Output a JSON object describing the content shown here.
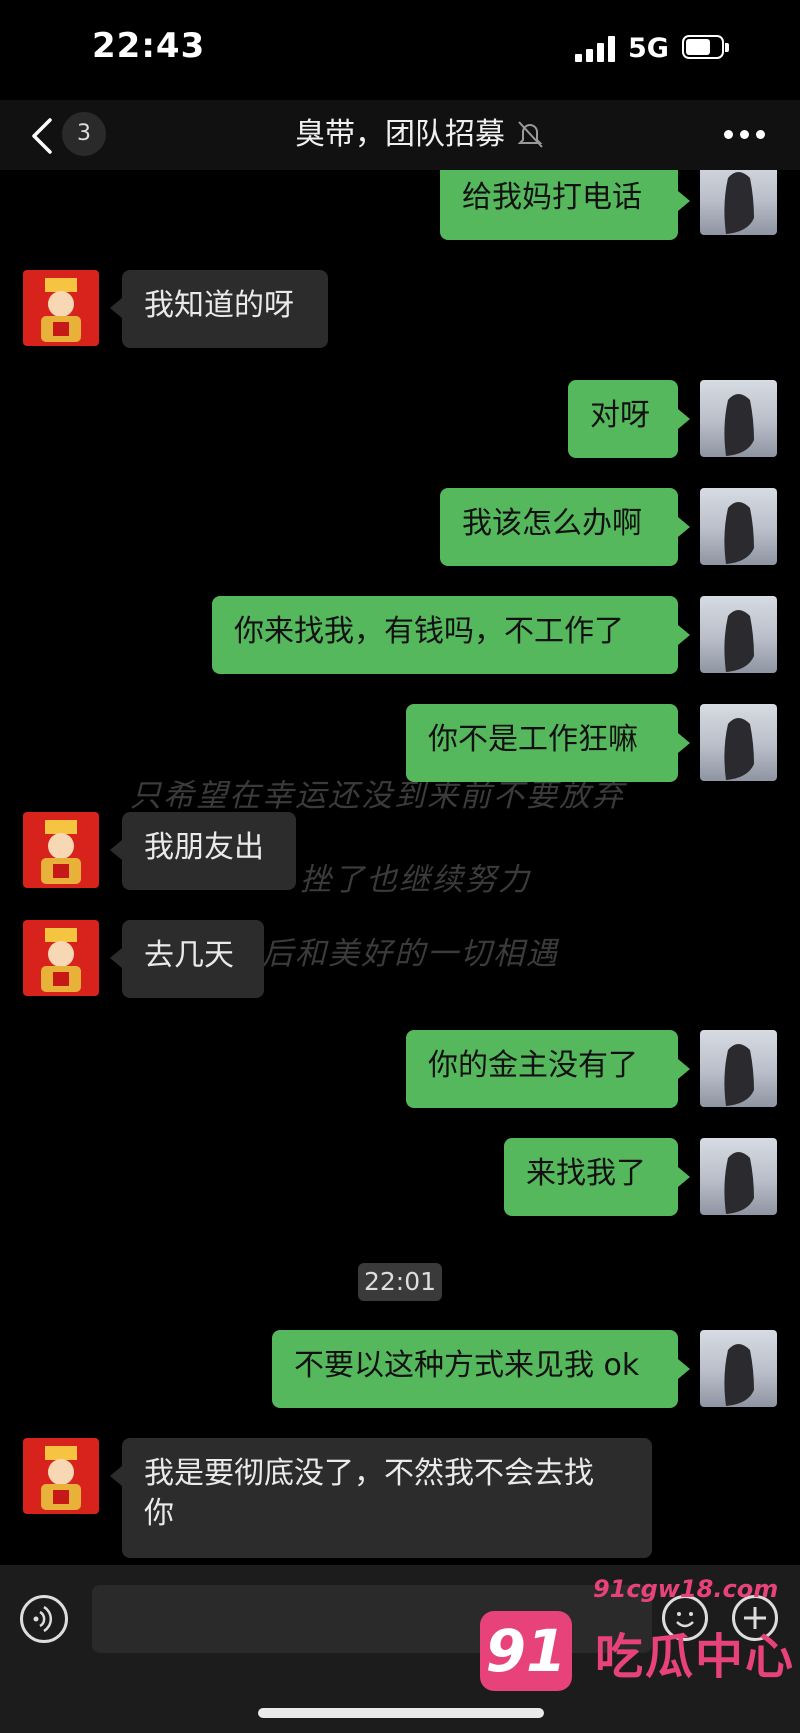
{
  "status": {
    "time": "22:43",
    "network": "5G"
  },
  "nav": {
    "back_count": "3",
    "title": "臭带，团队招募"
  },
  "watermark_lines": [
    "只希望在幸运还没到来前不要放弃",
    "挫了也继续努力",
    "后和美好的一切相遇"
  ],
  "messages": [
    {
      "from": "me",
      "text": "给我妈打电话"
    },
    {
      "from": "other",
      "text": "我知道的呀"
    },
    {
      "from": "me",
      "text": "对呀"
    },
    {
      "from": "me",
      "text": "我该怎么办啊"
    },
    {
      "from": "me",
      "text": "你来找我，有钱吗，不工作了"
    },
    {
      "from": "me",
      "text": "你不是工作狂嘛"
    },
    {
      "from": "other",
      "text": "我朋友出"
    },
    {
      "from": "other",
      "text": "去几天"
    },
    {
      "from": "me",
      "text": "你的金主没有了"
    },
    {
      "from": "me",
      "text": "来找我了"
    },
    {
      "from": "me",
      "text": "不要以这种方式来见我 ok"
    },
    {
      "from": "other",
      "text": "我是要彻底没了，不然我不会去找"
    },
    {
      "from": "other",
      "text": "你"
    }
  ],
  "timestamp": "22:01",
  "brand_logo": {
    "number": "91",
    "name": "吃瓜中心",
    "domain": "91cgw18.com"
  },
  "colors": {
    "my_bubble": "#56b85c",
    "their_bubble": "#2c2c2c",
    "background": "#000000",
    "logo": "#e8427a"
  },
  "icons": [
    "back-chevron-icon",
    "mute-bell-icon",
    "more-dots-icon",
    "voice-icon",
    "emoji-icon",
    "plus-icon"
  ]
}
